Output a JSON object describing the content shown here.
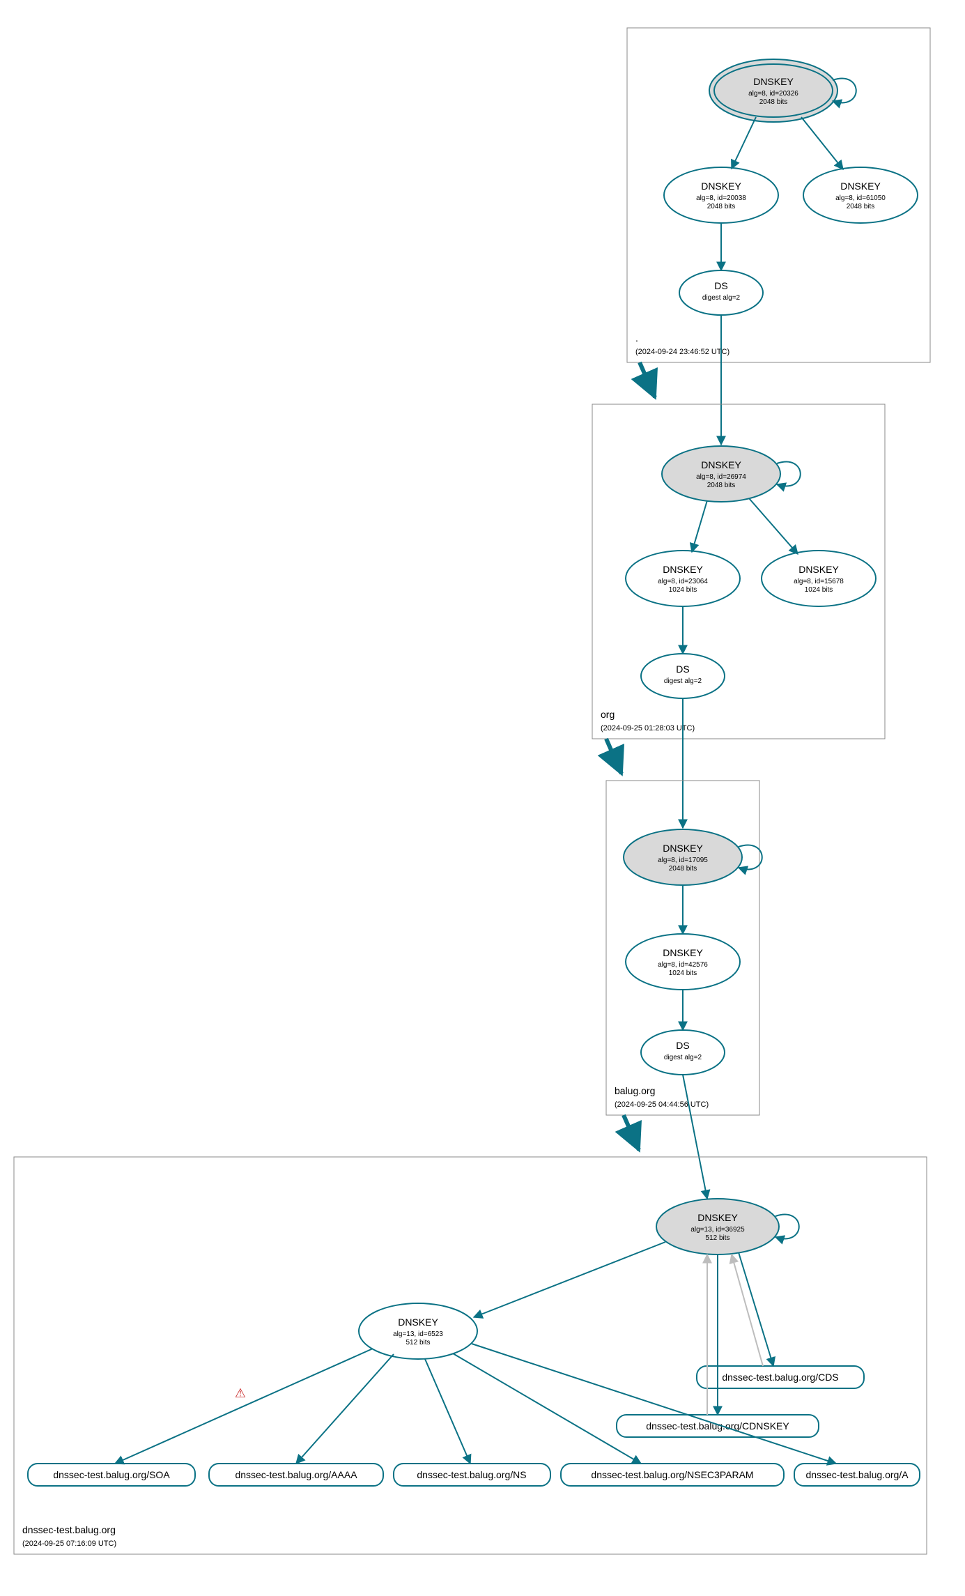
{
  "zones": {
    "root": {
      "name": ".",
      "timestamp": "(2024-09-24 23:46:52 UTC)",
      "ksk": {
        "title": "DNSKEY",
        "sub1": "alg=8, id=20326",
        "sub2": "2048 bits"
      },
      "zsk": {
        "title": "DNSKEY",
        "sub1": "alg=8, id=20038",
        "sub2": "2048 bits"
      },
      "extra": {
        "title": "DNSKEY",
        "sub1": "alg=8, id=61050",
        "sub2": "2048 bits"
      },
      "ds": {
        "title": "DS",
        "sub1": "digest alg=2"
      }
    },
    "org": {
      "name": "org",
      "timestamp": "(2024-09-25 01:28:03 UTC)",
      "ksk": {
        "title": "DNSKEY",
        "sub1": "alg=8, id=26974",
        "sub2": "2048 bits"
      },
      "zsk": {
        "title": "DNSKEY",
        "sub1": "alg=8, id=23064",
        "sub2": "1024 bits"
      },
      "extra": {
        "title": "DNSKEY",
        "sub1": "alg=8, id=15678",
        "sub2": "1024 bits"
      },
      "ds": {
        "title": "DS",
        "sub1": "digest alg=2"
      }
    },
    "balug": {
      "name": "balug.org",
      "timestamp": "(2024-09-25 04:44:56 UTC)",
      "ksk": {
        "title": "DNSKEY",
        "sub1": "alg=8, id=17095",
        "sub2": "2048 bits"
      },
      "zsk": {
        "title": "DNSKEY",
        "sub1": "alg=8, id=42576",
        "sub2": "1024 bits"
      },
      "ds": {
        "title": "DS",
        "sub1": "digest alg=2"
      }
    },
    "dnssectest": {
      "name": "dnssec-test.balug.org",
      "timestamp": "(2024-09-25 07:16:09 UTC)",
      "ksk": {
        "title": "DNSKEY",
        "sub1": "alg=13, id=36925",
        "sub2": "512 bits"
      },
      "zsk": {
        "title": "DNSKEY",
        "sub1": "alg=13, id=6523",
        "sub2": "512 bits"
      },
      "rr1": "dnssec-test.balug.org/CDS",
      "rr2": "dnssec-test.balug.org/CDNSKEY",
      "rr3": "dnssec-test.balug.org/SOA",
      "rr4": "dnssec-test.balug.org/AAAA",
      "rr5": "dnssec-test.balug.org/NS",
      "rr6": "dnssec-test.balug.org/NSEC3PARAM",
      "rr7": "dnssec-test.balug.org/A"
    }
  },
  "warning_icon": "⚠"
}
